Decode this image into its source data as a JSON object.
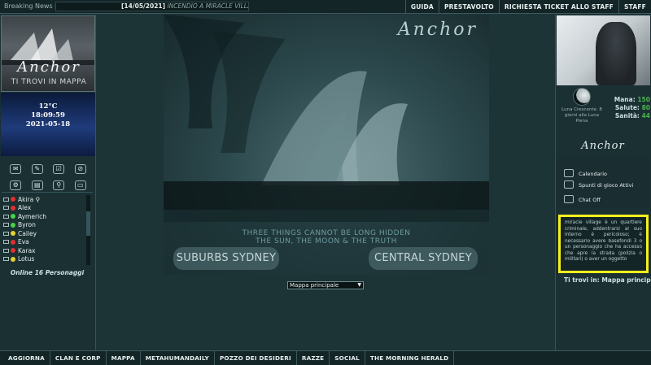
{
  "topbar": {
    "breaking_label": "Breaking News -",
    "news_date": "[14/05/2021]",
    "news_text": "INCENDIO A MIRACLE VILLAGE -",
    "nav": [
      "GUIDA",
      "PRESTAVOLTO",
      "RICHIESTA TICKET ALLO STAFF",
      "STAFF"
    ]
  },
  "left": {
    "logo_title": "Anchor",
    "logo_sub": "TI TROVI IN MAPPA",
    "weather": {
      "temp": "12°C",
      "time": "18:09:59",
      "date": "2021-05-18"
    },
    "icons": [
      "mail-icon",
      "chat-icon",
      "checklist-icon",
      "no-icon",
      "gear-icon",
      "map-icon",
      "pin-icon",
      "card-icon"
    ],
    "online": [
      {
        "name": "Akira",
        "status": "red"
      },
      {
        "name": "Alex",
        "status": "red"
      },
      {
        "name": "Aymerich",
        "status": "green"
      },
      {
        "name": "Byron",
        "status": "green"
      },
      {
        "name": "Cailey",
        "status": "yellow"
      },
      {
        "name": "Eva",
        "status": "red"
      },
      {
        "name": "Karax",
        "status": "red"
      },
      {
        "name": "Lotus",
        "status": "yellow"
      }
    ],
    "online_count": "Online 16 Personaggi"
  },
  "map": {
    "title": "Anchor",
    "line1": "THREE THINGS CANNOT BE LONG HIDDEN",
    "line2": "THE SUN, THE MOON & THE TRUTH",
    "button_left": "SUBURBS SYDNEY",
    "button_right": "CENTRAL SYDNEY",
    "select_value": "Mappa principale"
  },
  "right": {
    "moon_text": "Luna Crescente. 8 giorni alla Luna Piena",
    "stats": [
      {
        "label": "Mana:",
        "value": "150"
      },
      {
        "label": "Salute:",
        "value": "80"
      },
      {
        "label": "Sanità:",
        "value": "44"
      }
    ],
    "anchor_title": "Anchor",
    "menu": [
      "Calendario",
      "Spunti di gioco Attivi",
      "Chat Off"
    ],
    "info_text": "miracle village è un quartiere criminale, addentrarsi al suo interno è pericoloso; è necessario avere basefondi 3 o un personaggio che ha accesso che apre la strada (polizia o militari) o aver un oggetto",
    "location": "Ti trovi in: Mappa principale"
  },
  "bottombar": [
    "AGGIORNA",
    "CLAN E CORP",
    "MAPPA",
    "METAHUMANDAILY",
    "POZZO DEI DESIDERI",
    "RAZZE",
    "SOCIAL",
    "THE MORNING HERALD"
  ]
}
